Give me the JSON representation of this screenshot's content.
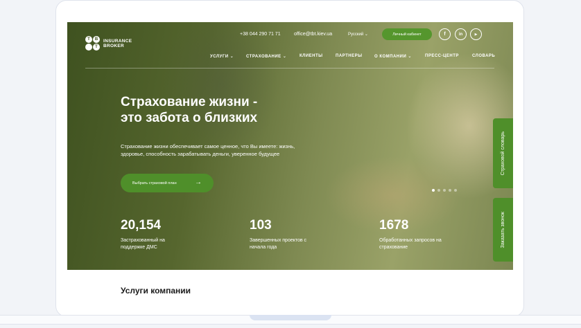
{
  "header": {
    "logo": {
      "letters": [
        "T",
        "B",
        "",
        "T"
      ],
      "line1": "INSURANCE",
      "line2": "BROKER"
    },
    "phone": "+38 044 290 71 71",
    "email": "office@tbt.kiev.ua",
    "language": "Русский ⌄",
    "cabinet_label": "Личный кабинет",
    "social": [
      "f",
      "in",
      "▶"
    ]
  },
  "nav": [
    {
      "label": "УСЛУГИ ⌄"
    },
    {
      "label": "СТРАХОВАНИЕ ⌄"
    },
    {
      "label": "КЛИЕНТЫ"
    },
    {
      "label": "ПАРТНЕРЫ"
    },
    {
      "label": "О КОМПАНИИ ⌄"
    },
    {
      "label": "ПРЕСС-ЦЕНТР"
    },
    {
      "label": "СЛОВАРЬ"
    }
  ],
  "hero": {
    "title_line1": "Страхование жизни -",
    "title_line2": "это забота о близких",
    "lead_line1": "Страхование жизни обеспечивает самое ценное, что Вы имеете: жизнь,",
    "lead_line2": "здоровье, способность зарабатывать деньги, уверенное будущее",
    "cta_label": "Выбрать страховой план",
    "cta_arrow": "→",
    "slides": 5,
    "active_slide": 0
  },
  "stats": [
    {
      "value": "20,154",
      "label_line1": "Застрахованный на",
      "label_line2": "поддержке ДМС"
    },
    {
      "value": "103",
      "label_line1": "Завершенных проектов с",
      "label_line2": "начала года"
    },
    {
      "value": "1678",
      "label_line1": "Обработанных запросов на",
      "label_line2": "страхование"
    }
  ],
  "side_tabs": {
    "dictionary": "Страховой словарь",
    "callback": "Заказать звонок"
  },
  "section_title": "Услуги компании",
  "colors": {
    "accent": "#55962d",
    "overlay": "#56662e"
  }
}
